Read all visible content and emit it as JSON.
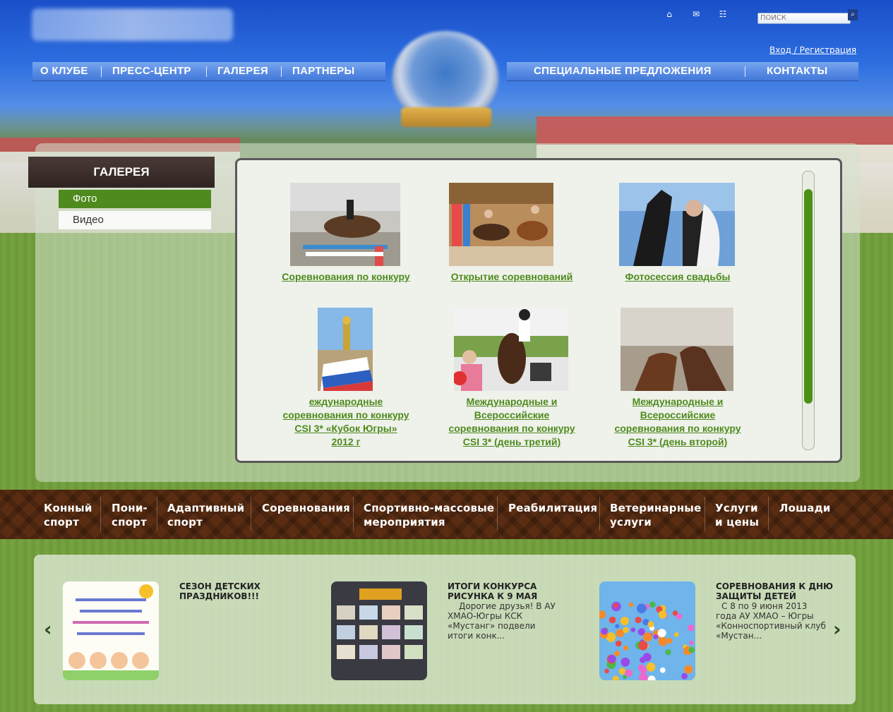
{
  "header": {
    "search_placeholder": "ПОИСК",
    "login_label": "Вход / Регистрация",
    "icons": [
      "home-icon",
      "mail-icon",
      "sitemap-icon",
      "search-icon"
    ]
  },
  "topnav": {
    "left": [
      "О КЛУБЕ",
      "ПРЕСС-ЦЕНТР",
      "ГАЛЕРЕЯ",
      "ПАРТНЕРЫ"
    ],
    "right": [
      "СПЕЦИАЛЬНЫЕ ПРЕДЛОЖЕНИЯ",
      "КОНТАКТЫ"
    ]
  },
  "sidebar": {
    "title": "ГАЛЕРЕЯ",
    "items": [
      {
        "label": "Фото",
        "active": true
      },
      {
        "label": "Видео",
        "active": false
      }
    ]
  },
  "gallery": {
    "items": [
      {
        "caption_lines": [
          "Соревнования по конкуру"
        ]
      },
      {
        "caption_lines": [
          "Открытие соревнований"
        ]
      },
      {
        "caption_lines": [
          "Фотосессия свадьбы"
        ]
      },
      {
        "caption_lines": [
          "еждународные",
          "соревнования по конкуру",
          "CSI 3* «Кубок Югры»",
          "2012 г"
        ]
      },
      {
        "caption_lines": [
          "Международные и",
          "Всероссийские",
          "соревнования по конкуру",
          "CSI 3* (день третий)"
        ]
      },
      {
        "caption_lines": [
          "Международные и",
          "Всероссийские",
          "соревнования по конкуру",
          "CSI 3* (день второй)"
        ]
      }
    ]
  },
  "categories": [
    [
      "Конный",
      "спорт"
    ],
    [
      "Пони-",
      "спорт"
    ],
    [
      "Адаптивный",
      "спорт"
    ],
    [
      "Соревнования"
    ],
    [
      "Спортивно-массовые",
      "мероприятия"
    ],
    [
      "Реабилитация"
    ],
    [
      "Ветеринарные",
      "услуги"
    ],
    [
      "Услуги",
      "и цены"
    ],
    [
      "Лошади"
    ]
  ],
  "news": [
    {
      "title": "СЕЗОН ДЕТСКИХ ПРАЗДНИКОВ!!!",
      "text": ""
    },
    {
      "title": "ИТОГИ КОНКУРСА РИСУНКА К 9 МАЯ",
      "text": "Дорогие друзья! В АУ ХМАО-Югры КСК «Мустанг» подвели итоги конк..."
    },
    {
      "title": "СОРЕВНОВАНИЯ К ДНЮ ЗАЩИТЫ ДЕТЕЙ",
      "text": "С 8 по 9 июня 2013 года АУ ХМАО – Югры «Конноспортивный клуб «Мустан..."
    }
  ],
  "colors": {
    "accent_green": "#4e8a1d",
    "nav_blue": "#5a8de4",
    "category_brown": "#5a2d12"
  }
}
